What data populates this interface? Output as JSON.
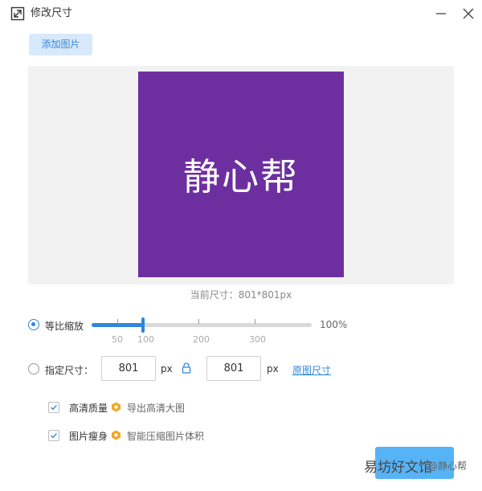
{
  "window": {
    "title": "修改尺寸"
  },
  "toolbar": {
    "add_image_label": "添加图片"
  },
  "preview": {
    "image_text": "静心帮"
  },
  "current_size": {
    "text": "当前尺寸：801*801px"
  },
  "proportional": {
    "label": "等比缩放",
    "selected": true,
    "slider": {
      "value_percent": 100,
      "value_label": "100%",
      "ticks": [
        {
          "label": "50",
          "value": 50
        },
        {
          "label": "100",
          "value": 100
        },
        {
          "label": "200",
          "value": 200
        },
        {
          "label": "300",
          "value": 300
        }
      ]
    }
  },
  "specified": {
    "label": "指定尺寸：",
    "selected": false,
    "width_value": "801",
    "height_value": "801",
    "unit": "px",
    "original_size_link": "原图尺寸"
  },
  "options": {
    "high_quality": {
      "label": "高清质量",
      "hint": "导出高清大图",
      "checked": true
    },
    "slim": {
      "label": "图片瘦身",
      "hint": "智能压缩图片体积",
      "checked": true
    }
  },
  "watermark": {
    "text": "易坊好文馆",
    "sub": "@静心帮"
  },
  "colors": {
    "accent": "#2f86dd",
    "preview_bg": "#6d2fa0",
    "hint_orange": "#f5a623"
  }
}
